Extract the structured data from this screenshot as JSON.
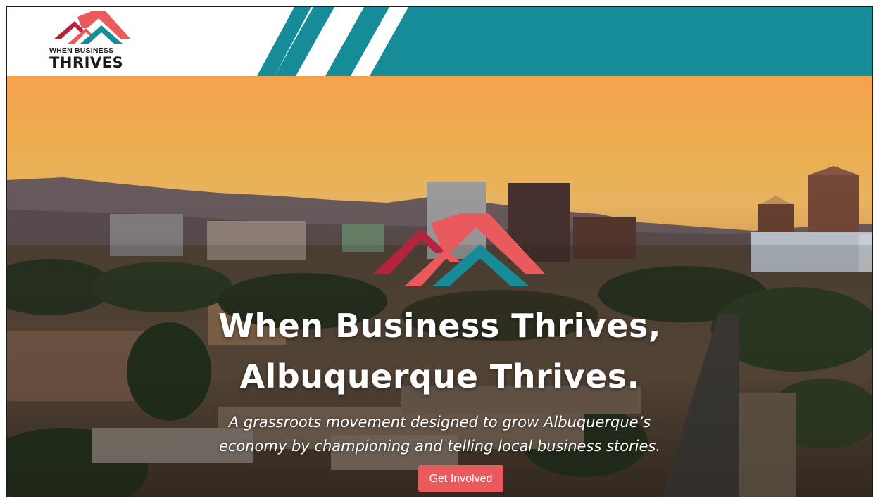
{
  "header": {
    "logo_line1": "WHEN BUSINESS",
    "logo_line2": "THRIVES",
    "teal_color": "#168c99"
  },
  "hero": {
    "headline_line1": "When Business Thrives,",
    "headline_line2": "Albuquerque Thrives.",
    "tagline_line1": "A grassroots movement designed to grow Albuquerque’s",
    "tagline_line2": "economy by championing and telling local business stories.",
    "cta_label": "Get Involved",
    "background_image": "sunset-city-skyline"
  },
  "colors": {
    "brand_red": "#b5243f",
    "brand_coral": "#ea5a5c",
    "brand_teal": "#168c99",
    "cta": "#ea5a5c"
  },
  "icons": {
    "logo_mark": "mountain-chevrons-icon"
  }
}
